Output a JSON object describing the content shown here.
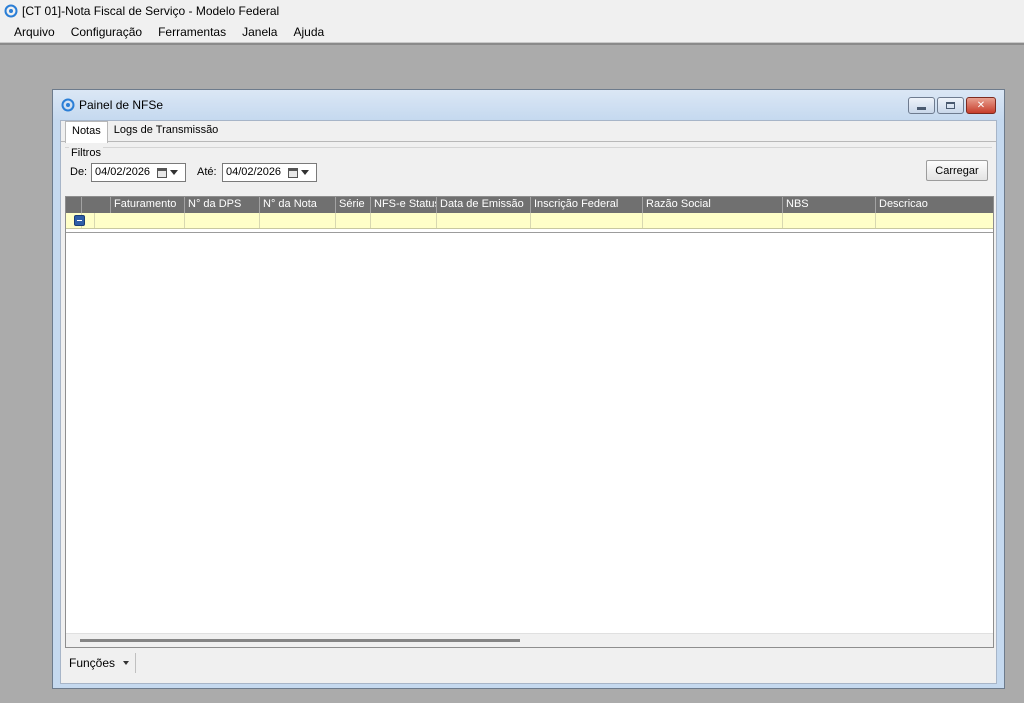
{
  "app": {
    "title": "[CT 01]-Nota Fiscal de Serviço - Modelo Federal",
    "menu": [
      "Arquivo",
      "Configuração",
      "Ferramentas",
      "Janela",
      "Ajuda"
    ]
  },
  "child": {
    "title": "Painel de NFSe",
    "tabs": [
      "Notas",
      "Logs de Transmissão"
    ],
    "active_tab": "Notas"
  },
  "filters": {
    "legend": "Filtros",
    "from_label": "De:",
    "from_value": "04/02/2026",
    "to_label": "Até:",
    "to_value": "04/02/2026",
    "load_button": "Carregar"
  },
  "grid": {
    "columns": [
      "",
      "",
      "Faturamento",
      "N° da DPS",
      "N° da Nota",
      "Série",
      "NFS-e Status",
      "Data de Emissão",
      "Inscrição Federal",
      "Razão Social",
      "NBS",
      "Descricao"
    ]
  },
  "footer": {
    "functions_label": "Funções"
  },
  "colors": {
    "row_highlight": "#ffffc8",
    "header_bg": "#707070",
    "workspace": "#ababab"
  }
}
